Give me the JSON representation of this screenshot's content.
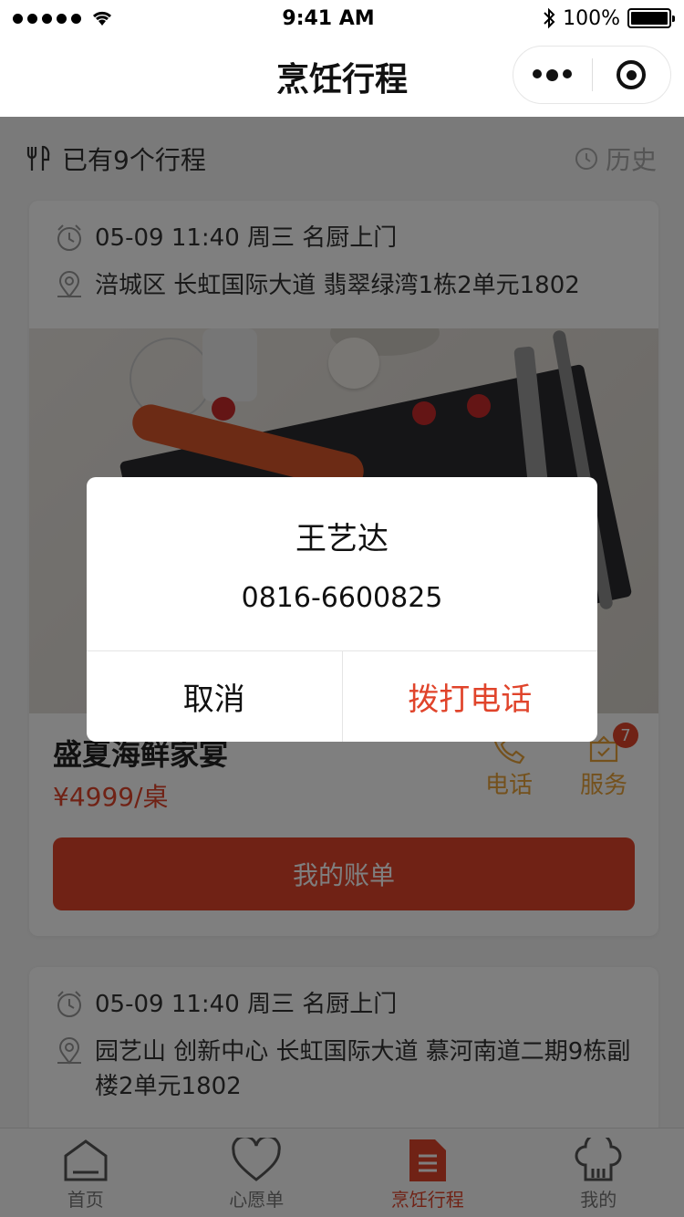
{
  "status_bar": {
    "time": "9:41 AM",
    "battery": "100%"
  },
  "nav": {
    "title": "烹饪行程"
  },
  "summary": {
    "count_text": "已有9个行程",
    "history_label": "历史"
  },
  "trips": [
    {
      "datetime": "05-09 11:40 周三 名厨上门",
      "address": "涪城区 长虹国际大道 翡翠绿湾1栋2单元1802",
      "dish_name": "盛夏海鲜家宴",
      "price": "¥4999/桌",
      "phone_label": "电话",
      "service_label": "服务",
      "service_badge": "7",
      "bill_button": "我的账单"
    },
    {
      "datetime": "05-09 11:40 周三 名厨上门",
      "address": "园艺山 创新中心 长虹国际大道 慕河南道二期9栋副楼2单元1802"
    }
  ],
  "tabbar": {
    "items": [
      {
        "label": "首页",
        "icon": "home-icon",
        "active": false
      },
      {
        "label": "心愿单",
        "icon": "heart-icon",
        "active": false
      },
      {
        "label": "烹饪行程",
        "icon": "document-icon",
        "active": true
      },
      {
        "label": "我的",
        "icon": "chef-hat-icon",
        "active": false
      }
    ]
  },
  "dialog": {
    "title": "王艺达",
    "phone": "0816-6600825",
    "cancel_label": "取消",
    "confirm_label": "拨打电话"
  },
  "colors": {
    "accent": "#e0442b",
    "action": "#e8a33a"
  }
}
